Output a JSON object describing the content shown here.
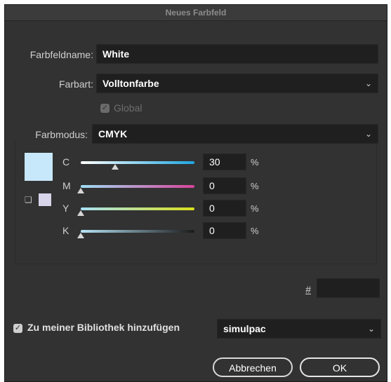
{
  "title": "Neues Farbfeld",
  "name_field": {
    "label": "Farbfeldname:",
    "value": "White"
  },
  "color_type": {
    "label": "Farbart:",
    "value": "Volltonfarbe"
  },
  "global": {
    "label": "Global",
    "checked": true,
    "disabled": true
  },
  "color_mode": {
    "label": "Farbmodus:",
    "value": "CMYK"
  },
  "swatch_color": "#c7e8fb",
  "gamut_swatch_color": "#d8d4ea",
  "channels": [
    {
      "label": "C",
      "value": "30",
      "unit": "%",
      "level": 0.3
    },
    {
      "label": "M",
      "value": "0",
      "unit": "%",
      "level": 0.0
    },
    {
      "label": "Y",
      "value": "0",
      "unit": "%",
      "level": 0.0
    },
    {
      "label": "K",
      "value": "0",
      "unit": "%",
      "level": 0.0
    }
  ],
  "hex": {
    "label": "#",
    "value": ""
  },
  "library": {
    "label": "Zu meiner Bibliothek hinzufügen",
    "checked": true,
    "value": "simulpac"
  },
  "buttons": {
    "cancel": "Abbrechen",
    "ok": "OK"
  }
}
